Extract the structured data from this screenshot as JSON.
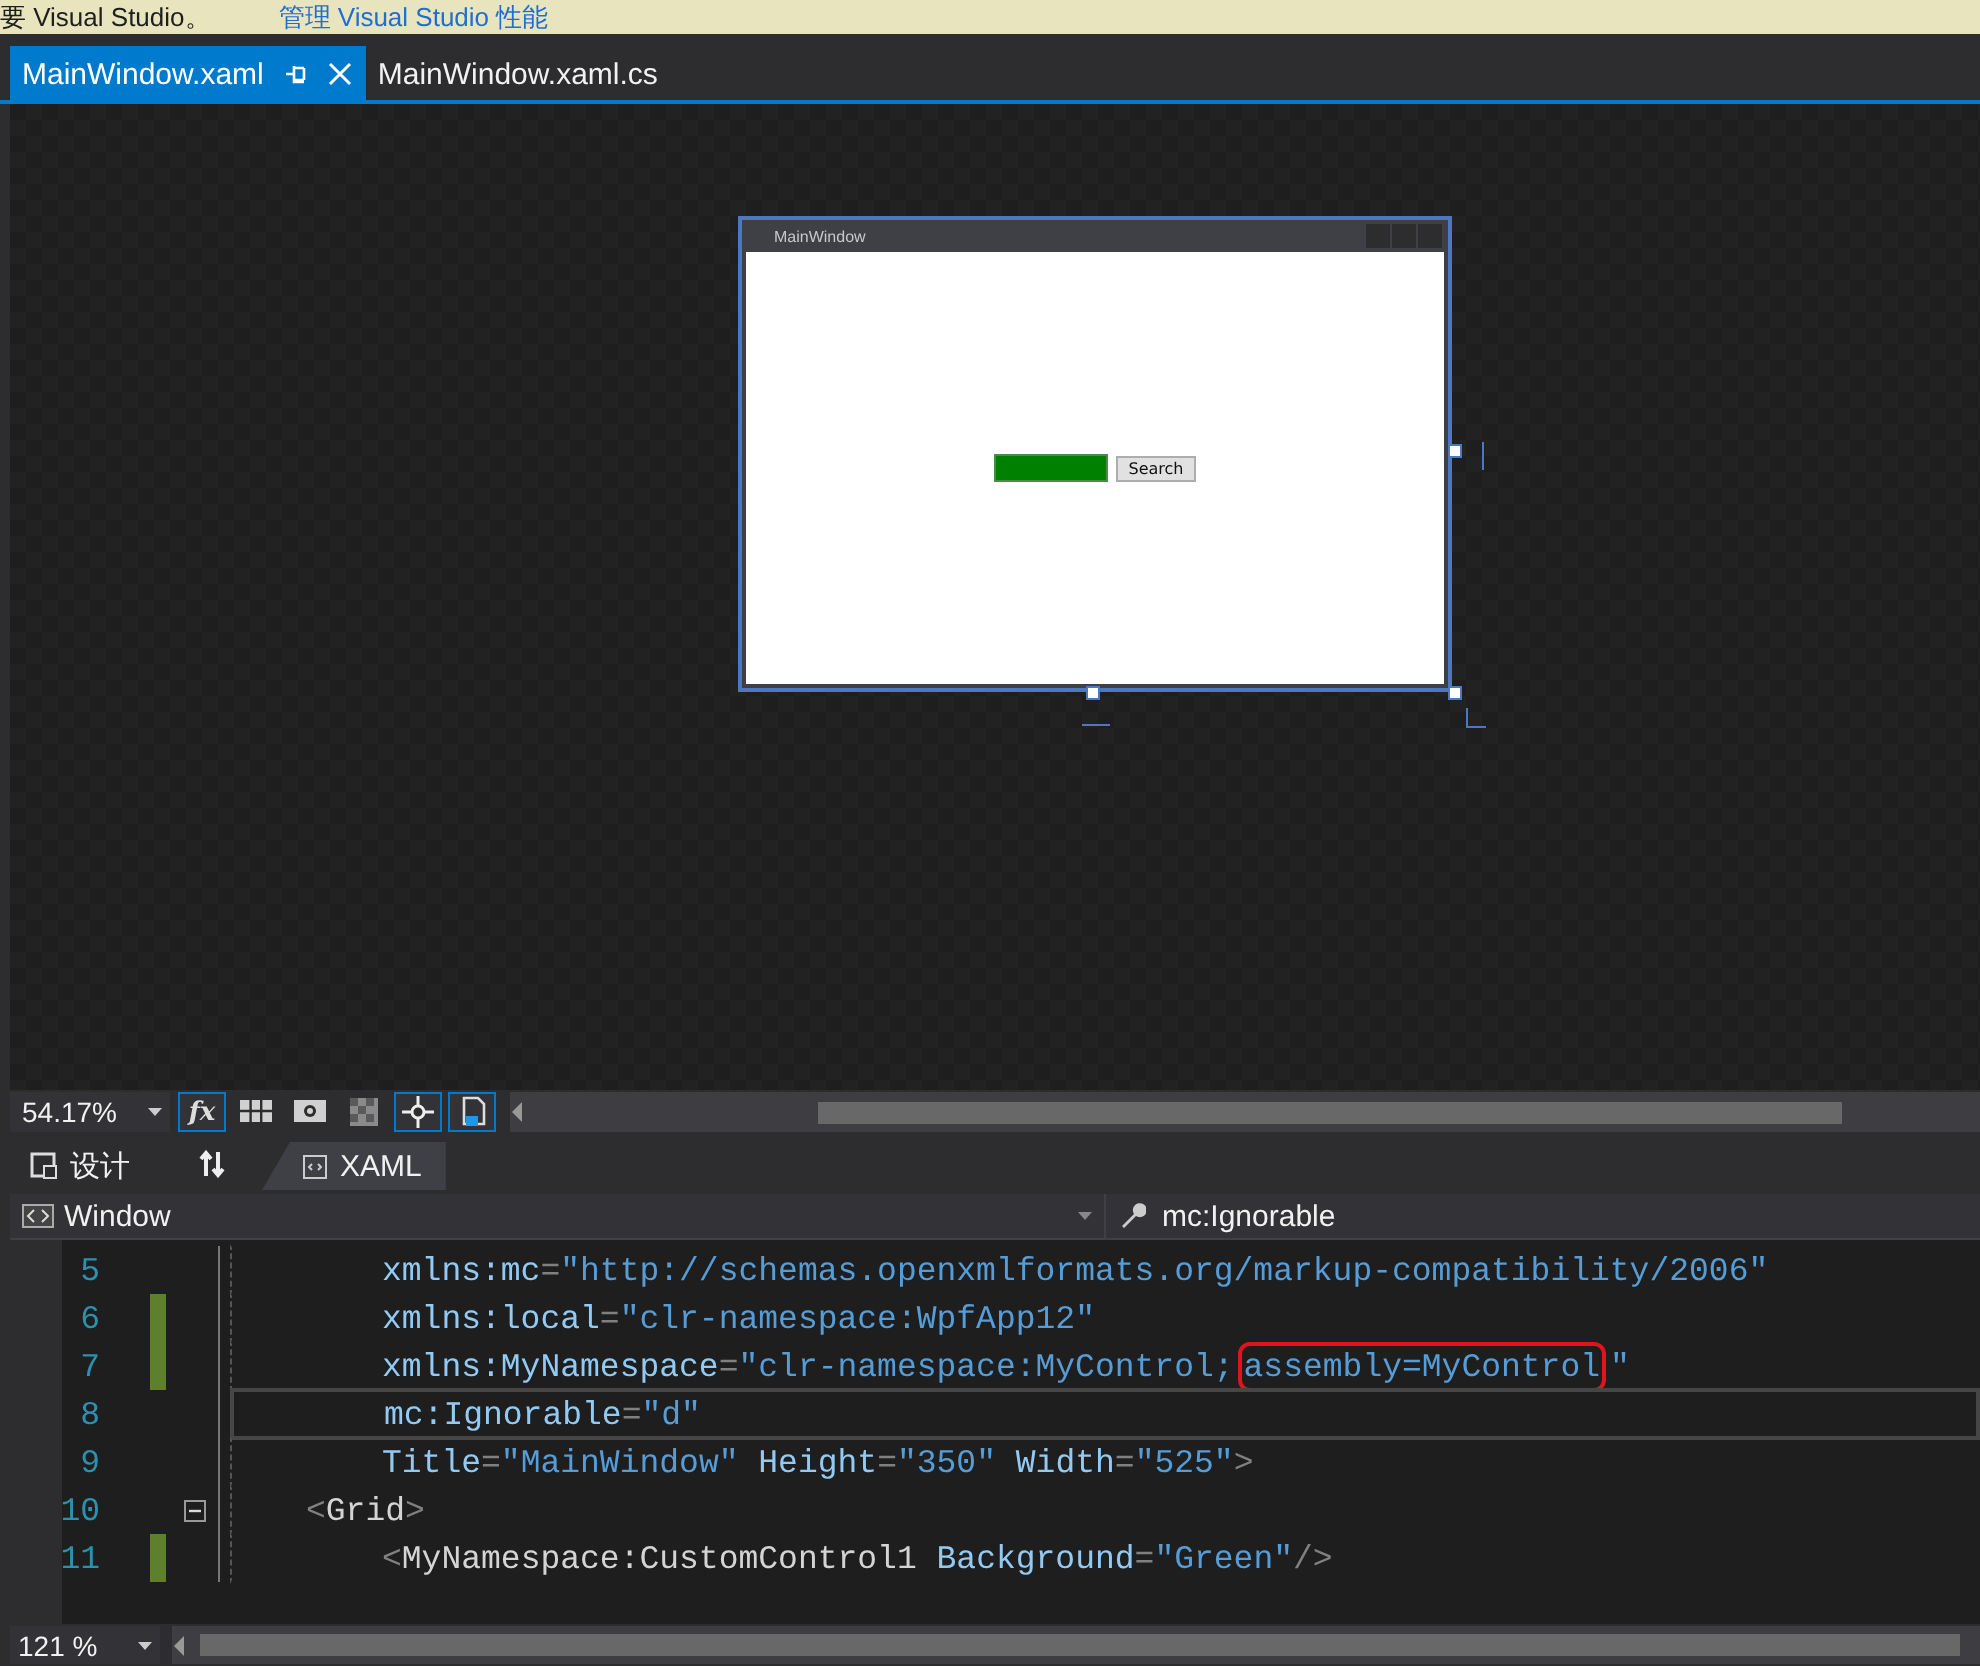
{
  "info_bar": {
    "message": "要 Visual Studio。",
    "link": "管理 Visual Studio 性能"
  },
  "document_tabs": [
    {
      "label": "MainWindow.xaml",
      "selected": true
    },
    {
      "label": "MainWindow.xaml.cs",
      "selected": false
    }
  ],
  "designer": {
    "preview_window": {
      "title": "MainWindow",
      "button": "Search"
    }
  },
  "designer_toolbar": {
    "zoom": "54.17%",
    "tools": [
      {
        "kind": "effects",
        "label": "fx",
        "on": true
      },
      {
        "kind": "grid",
        "on": false
      },
      {
        "kind": "snap-grid",
        "on": false
      },
      {
        "kind": "checker",
        "on": false
      },
      {
        "kind": "snap-lines",
        "on": true
      },
      {
        "kind": "project-code",
        "on": true
      }
    ]
  },
  "view_tabs": [
    {
      "label": "设计",
      "selected": false
    },
    {
      "label": "XAML",
      "selected": true
    }
  ],
  "nav_bar": {
    "element": "Window",
    "member": "mc:Ignorable"
  },
  "code_lines": [
    {
      "number": "5",
      "kind": "attribute",
      "changed": false,
      "current": false,
      "foldable": false,
      "tokens": [
        {
          "kind": "name",
          "text": "xmlns:mc"
        },
        {
          "kind": "punct",
          "text": "="
        },
        {
          "kind": "value",
          "text": "\"http://schemas.openxmlformats.org/markup-compatibility/2006\""
        }
      ]
    },
    {
      "number": "6",
      "kind": "attribute",
      "changed": true,
      "current": false,
      "foldable": false,
      "tokens": [
        {
          "kind": "name",
          "text": "xmlns:local"
        },
        {
          "kind": "punct",
          "text": "="
        },
        {
          "kind": "value",
          "text": "\"clr-namespace:WpfApp12\""
        }
      ]
    },
    {
      "number": "7",
      "kind": "attribute",
      "changed": true,
      "current": false,
      "foldable": false,
      "tokens": [
        {
          "kind": "name",
          "text": "xmlns:MyNamespace"
        },
        {
          "kind": "punct",
          "text": "="
        },
        {
          "kind": "value",
          "text": "\"clr-namespace:MyControl;"
        },
        {
          "kind": "value",
          "text": "assembly=MyControl",
          "highlighted": true
        },
        {
          "kind": "value",
          "text": "\""
        }
      ]
    },
    {
      "number": "8",
      "kind": "attribute",
      "changed": false,
      "current": true,
      "foldable": false,
      "tokens": [
        {
          "kind": "name",
          "text": "mc:Ignorable"
        },
        {
          "kind": "punct",
          "text": "="
        },
        {
          "kind": "value",
          "text": "\"d\""
        }
      ]
    },
    {
      "number": "9",
      "kind": "attribute",
      "changed": false,
      "current": false,
      "foldable": false,
      "tokens": [
        {
          "kind": "name",
          "text": "Title"
        },
        {
          "kind": "punct",
          "text": "="
        },
        {
          "kind": "value",
          "text": "\"MainWindow\""
        },
        {
          "kind": "name",
          "text": " Height"
        },
        {
          "kind": "punct",
          "text": "="
        },
        {
          "kind": "value",
          "text": "\"350\""
        },
        {
          "kind": "name",
          "text": " Width"
        },
        {
          "kind": "punct",
          "text": "="
        },
        {
          "kind": "value",
          "text": "\"525\""
        },
        {
          "kind": "punct",
          "text": ">"
        }
      ]
    },
    {
      "number": "10",
      "kind": "element",
      "changed": false,
      "current": false,
      "foldable": true,
      "tokens": [
        {
          "kind": "punct",
          "text": "<"
        },
        {
          "kind": "element",
          "text": "Grid"
        },
        {
          "kind": "punct",
          "text": ">"
        }
      ]
    },
    {
      "number": "11",
      "kind": "child",
      "changed": true,
      "current": false,
      "foldable": false,
      "tokens": [
        {
          "kind": "punct",
          "text": "<"
        },
        {
          "kind": "element",
          "text": "MyNamespace:CustomControl1"
        },
        {
          "kind": "name",
          "text": " Background"
        },
        {
          "kind": "punct",
          "text": "="
        },
        {
          "kind": "value",
          "text": "\"Green\""
        },
        {
          "kind": "punct",
          "text": "/>"
        }
      ]
    }
  ],
  "editor_zoom": "121 %"
}
